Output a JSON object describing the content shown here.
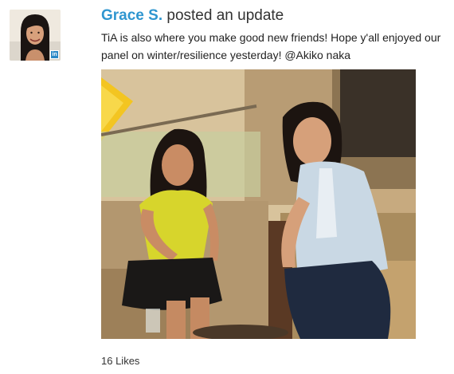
{
  "post": {
    "author_name": "Grace S.",
    "action_text": "posted an update",
    "message_text": "TiA is also where you make good new friends! Hope y'all enjoyed our panel on winter/resilience yesterday! ",
    "mention_text": "@Akiko naka",
    "likes_text": "16 Likes",
    "avatar_icon": "profile-photo",
    "avatar_badge_icon": "linkedin-badge-icon",
    "colors": {
      "author_link": "#2f96d0",
      "text": "#222222"
    }
  }
}
